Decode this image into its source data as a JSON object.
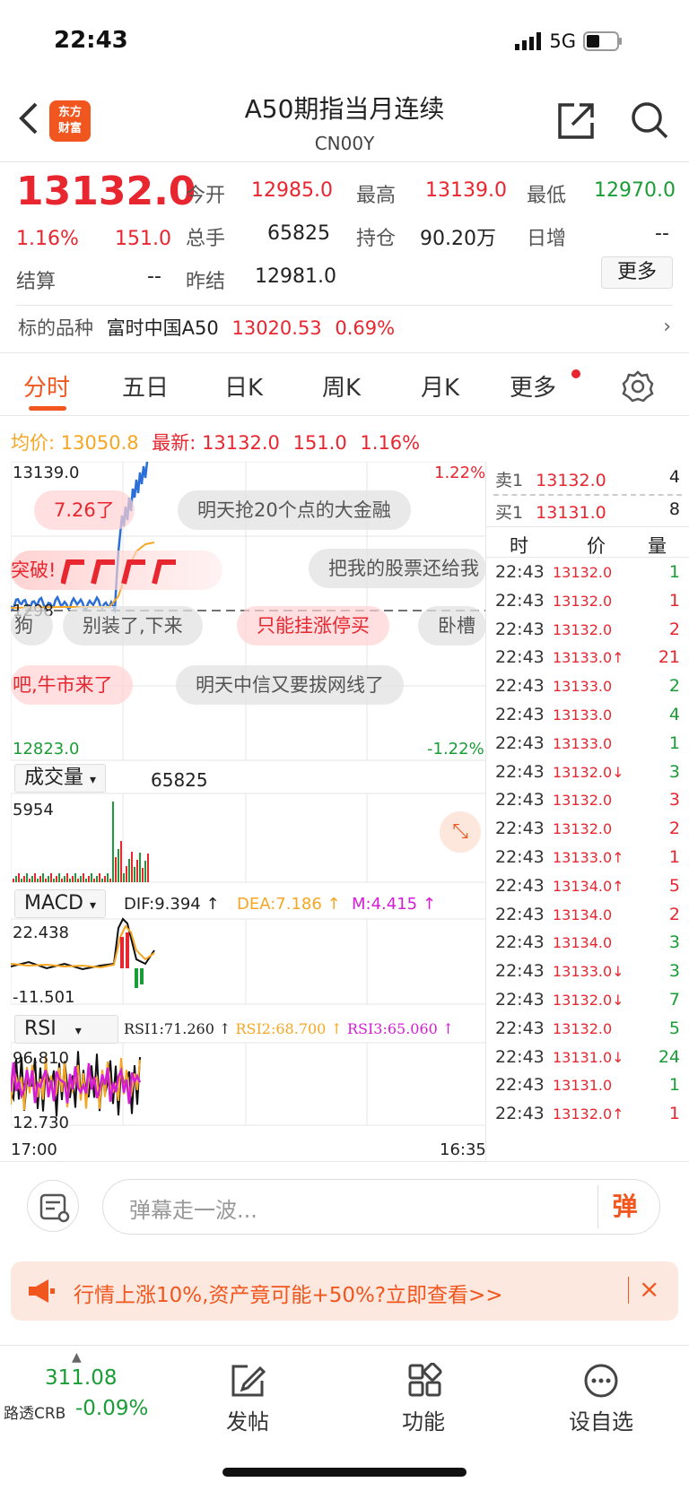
{
  "status": {
    "time": "22:43",
    "network": "5G"
  },
  "header": {
    "logo_text_1": "东方",
    "logo_text_2": "财富",
    "title": "A50期指当月连续",
    "subtitle": "CN00Y"
  },
  "quote": {
    "price": "13132.0",
    "change_pct": "1.16%",
    "change": "151.0",
    "open_label": "今开",
    "open": "12985.0",
    "high_label": "最高",
    "high": "13139.0",
    "low_label": "最低",
    "low": "12970.0",
    "volume_label": "总手",
    "volume": "65825",
    "oi_label": "持仓",
    "oi": "90.20万",
    "daily_inc_label": "日增",
    "daily_inc": "--",
    "settle_label": "结算",
    "settle": "--",
    "prev_settle_label": "昨结",
    "prev_settle": "12981.0",
    "more": "更多"
  },
  "underlying": {
    "label": "标的品种",
    "name": "富时中国A50",
    "price": "13020.53",
    "pct": "0.69%"
  },
  "tabs": [
    "分时",
    "五日",
    "日K",
    "周K",
    "月K",
    "更多"
  ],
  "avg_bar": {
    "avg_label": "均价:",
    "avg": "13050.8",
    "last_label": "最新:",
    "last": "13132.0",
    "change": "151.0",
    "pct": "1.16%"
  },
  "chart_labels": {
    "top_price": "13139.0",
    "top_pct": "1.22%",
    "mid_price": "1298",
    "bottom_price": "12823.0",
    "bottom_pct": "-1.22%",
    "volume_select": "成交量",
    "volume_value": "65825",
    "volume_max": "5954",
    "macd_select": "MACD",
    "dif": "DIF:9.394 ↑",
    "dea": "DEA:7.186 ↑",
    "m": "M:4.415 ↑",
    "macd_max": "22.438",
    "macd_min": "-11.501",
    "rsi_select": "RSI",
    "rsi1": "RSI1:71.260 ↑",
    "rsi2": "RSI2:68.700 ↑",
    "rsi3": "RSI3:65.060 ↑",
    "rsi_max": "96.810",
    "rsi_min": "12.730",
    "x_start": "17:00",
    "x_end": "16:35"
  },
  "danmaku": [
    "7.26了",
    "明天抢20个点的大金融",
    "突破!",
    "把我的股票还给我",
    "狗",
    "别装了,下来",
    "只能挂涨停买",
    "卧槽",
    "吧,牛市来了",
    "明天中信又要拔网线了"
  ],
  "order_book": {
    "sell_label": "卖1",
    "sell_price": "13132.0",
    "sell_vol": "4",
    "buy_label": "买1",
    "buy_price": "13131.0",
    "buy_vol": "8",
    "col_time": "时",
    "col_price": "价",
    "col_vol": "量"
  },
  "ticks": [
    {
      "t": "22:43",
      "p": "13132.0",
      "v": "1",
      "pc": "red",
      "vc": "green"
    },
    {
      "t": "22:43",
      "p": "13132.0",
      "v": "1",
      "pc": "red",
      "vc": "red"
    },
    {
      "t": "22:43",
      "p": "13132.0",
      "v": "2",
      "pc": "red",
      "vc": "red"
    },
    {
      "t": "22:43",
      "p": "13133.0↑",
      "v": "21",
      "pc": "red",
      "vc": "red"
    },
    {
      "t": "22:43",
      "p": "13133.0",
      "v": "2",
      "pc": "red",
      "vc": "green"
    },
    {
      "t": "22:43",
      "p": "13133.0",
      "v": "4",
      "pc": "red",
      "vc": "green"
    },
    {
      "t": "22:43",
      "p": "13133.0",
      "v": "1",
      "pc": "red",
      "vc": "green"
    },
    {
      "t": "22:43",
      "p": "13132.0↓",
      "v": "3",
      "pc": "red",
      "vc": "green"
    },
    {
      "t": "22:43",
      "p": "13132.0",
      "v": "3",
      "pc": "red",
      "vc": "red"
    },
    {
      "t": "22:43",
      "p": "13132.0",
      "v": "2",
      "pc": "red",
      "vc": "red"
    },
    {
      "t": "22:43",
      "p": "13133.0↑",
      "v": "1",
      "pc": "red",
      "vc": "red"
    },
    {
      "t": "22:43",
      "p": "13134.0↑",
      "v": "5",
      "pc": "red",
      "vc": "red"
    },
    {
      "t": "22:43",
      "p": "13134.0",
      "v": "2",
      "pc": "red",
      "vc": "red"
    },
    {
      "t": "22:43",
      "p": "13134.0",
      "v": "3",
      "pc": "red",
      "vc": "green"
    },
    {
      "t": "22:43",
      "p": "13133.0↓",
      "v": "3",
      "pc": "red",
      "vc": "green"
    },
    {
      "t": "22:43",
      "p": "13132.0↓",
      "v": "7",
      "pc": "red",
      "vc": "green"
    },
    {
      "t": "22:43",
      "p": "13132.0",
      "v": "5",
      "pc": "red",
      "vc": "green"
    },
    {
      "t": "22:43",
      "p": "13131.0↓",
      "v": "24",
      "pc": "red",
      "vc": "green"
    },
    {
      "t": "22:43",
      "p": "13131.0",
      "v": "1",
      "pc": "red",
      "vc": "green"
    },
    {
      "t": "22:43",
      "p": "13132.0↑",
      "v": "1",
      "pc": "red",
      "vc": "red"
    }
  ],
  "comment": {
    "placeholder": "弹幕走一波...",
    "danmaku_button": "弹"
  },
  "ad": {
    "text": "行情上涨10%,资产竟可能+50%?立即查看>>"
  },
  "bottom_nav": {
    "crb_value": "311.08",
    "crb_label": "路透CRB",
    "crb_pct": "-0.09%",
    "post": "发帖",
    "functions": "功能",
    "watchlist": "设自选"
  },
  "colors": {
    "red": "#e8262f",
    "green": "#1a9d36",
    "orange": "#f6a623",
    "brand": "#f0561e",
    "magenta": "#d61dd6"
  }
}
